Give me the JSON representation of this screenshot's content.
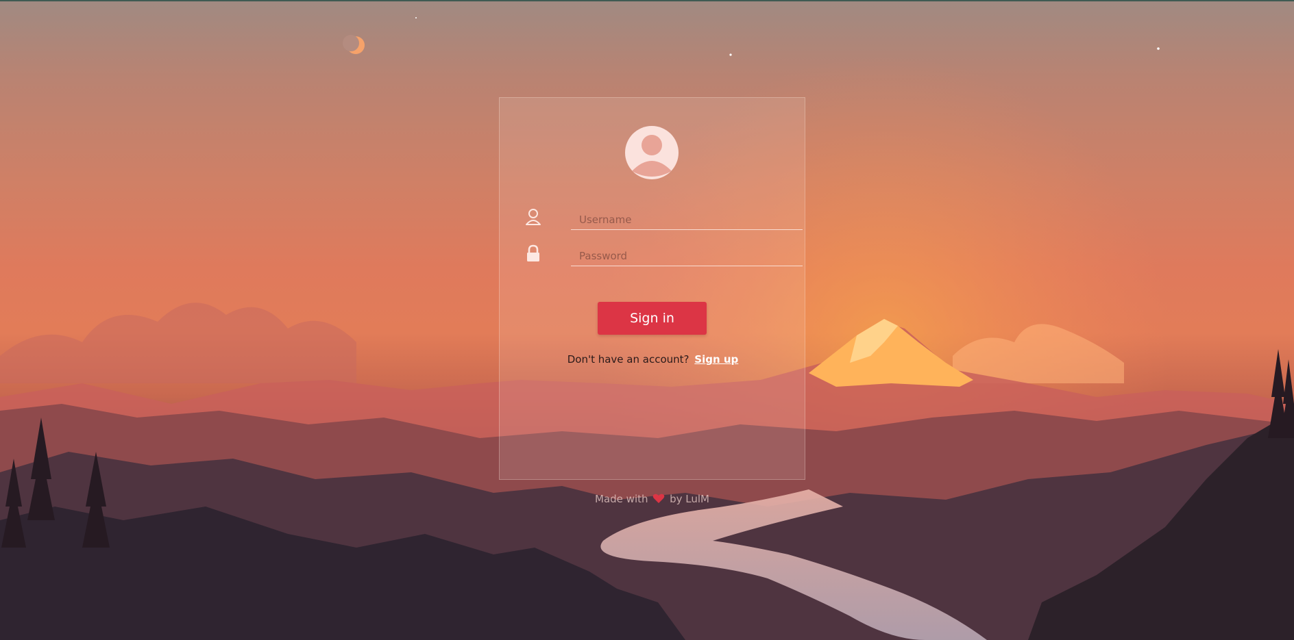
{
  "login": {
    "username_placeholder": "Username",
    "password_placeholder": "Password",
    "signin_label": "Sign in",
    "no_account_text": "Don't have an account?",
    "signup_label": "Sign up"
  },
  "footer": {
    "prefix": "Made with",
    "suffix": "by LulM"
  },
  "icons": {
    "avatar": "user-avatar-icon",
    "username": "user-icon",
    "password": "lock-icon",
    "footer": "heart-icon"
  },
  "colors": {
    "accent": "#dc3545",
    "heart": "#dc3545"
  }
}
